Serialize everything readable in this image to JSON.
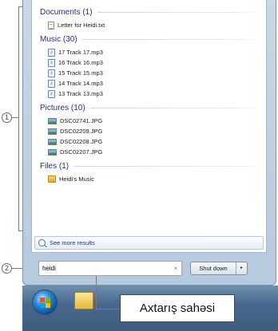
{
  "groups": [
    {
      "header": "Documents (1)",
      "items": [
        {
          "label": "Letter for Heidi.txt",
          "icon": "text-document-icon"
        }
      ]
    },
    {
      "header": "Music (30)",
      "items": [
        {
          "label": "17 Track 17.mp3",
          "icon": "music-file-icon"
        },
        {
          "label": "16 Track 16.mp3",
          "icon": "music-file-icon"
        },
        {
          "label": "15 Track 15.mp3",
          "icon": "music-file-icon"
        },
        {
          "label": "14 Track 14.mp3",
          "icon": "music-file-icon"
        },
        {
          "label": "13 Track 13.mp3",
          "icon": "music-file-icon"
        }
      ]
    },
    {
      "header": "Pictures (10)",
      "items": [
        {
          "label": "DSC02741.JPG",
          "icon": "image-file-icon"
        },
        {
          "label": "DSC02209.JPG",
          "icon": "image-file-icon"
        },
        {
          "label": "DSC02208.JPG",
          "icon": "image-file-icon"
        },
        {
          "label": "DSC02207.JPG",
          "icon": "image-file-icon"
        }
      ]
    },
    {
      "header": "Files (1)",
      "items": [
        {
          "label": "Heidi's Music",
          "icon": "folder-icon"
        }
      ]
    }
  ],
  "see_more": {
    "label": "See more results",
    "icon": "search-icon"
  },
  "search": {
    "value": "heidi",
    "clear": "×"
  },
  "shutdown": {
    "label": "Shut down",
    "arrow": "▸"
  },
  "callouts": {
    "marker1": "1",
    "marker2": "2",
    "search_area_label": "Axtarış sahəsi"
  },
  "taskbar": {
    "start_icon": "windows-start-orb-icon",
    "explorer_icon": "windows-explorer-icon"
  },
  "colors": {
    "group_header": "#1e3287",
    "taskbar": "#48698c",
    "frame": "#c9d7e6"
  }
}
